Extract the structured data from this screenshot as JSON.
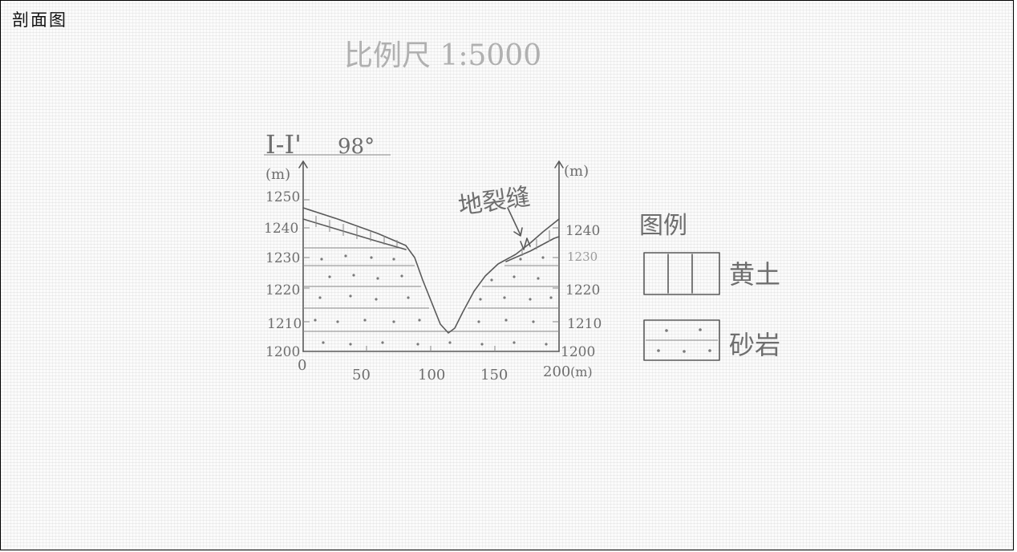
{
  "title": "剖面图",
  "scale": "比例尺 1:5000",
  "section": {
    "label": "I-I'",
    "angle": "98°"
  },
  "axes": {
    "left_unit": "(m)",
    "right_unit": "(m)",
    "x_unit": "(m)",
    "y_ticks_left": [
      "1250",
      "1240",
      "1230",
      "1220",
      "1210",
      "1200"
    ],
    "y_ticks_right": [
      "1240",
      "1230",
      "1220",
      "1210",
      "1200"
    ],
    "x_ticks": [
      "0",
      "50",
      "100",
      "150",
      "200"
    ]
  },
  "annotation": "地裂缝",
  "legend": {
    "title": "图例",
    "items": [
      {
        "label": "黄土",
        "pattern": "vertical-lines"
      },
      {
        "label": "砂岩",
        "pattern": "dots"
      }
    ]
  }
}
